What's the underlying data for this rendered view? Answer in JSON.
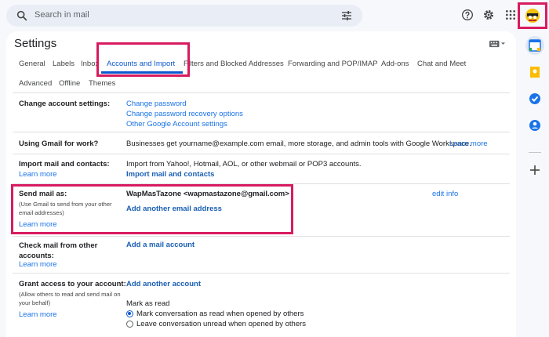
{
  "search": {
    "placeholder": "Search in mail"
  },
  "settings": {
    "title": "Settings",
    "tabs_row1": [
      "General",
      "Labels",
      "Inbox",
      "Accounts and Import",
      "Filters and Blocked Addresses",
      "Forwarding and POP/IMAP",
      "Add-ons",
      "Chat and Meet"
    ],
    "tabs_row2": [
      "Advanced",
      "Offline",
      "Themes"
    ],
    "active_tab": "Accounts and Import"
  },
  "rows": {
    "change_account": {
      "label": "Change account settings:",
      "links": [
        "Change password",
        "Change password recovery options",
        "Other Google Account settings"
      ]
    },
    "gmail_work": {
      "label": "Using Gmail for work?",
      "text": "Businesses get yourname@example.com email, more storage, and admin tools with Google Workspace.",
      "link": "Learn more"
    },
    "import": {
      "label": "Import mail and contacts:",
      "learn_more": "Learn more",
      "text": "Import from Yahoo!, Hotmail, AOL, or other webmail or POP3 accounts.",
      "action": "Import mail and contacts"
    },
    "send_as": {
      "label": "Send mail as:",
      "sub": "(Use Gmail to send from your other email addresses)",
      "learn_more": "Learn more",
      "address": "WapMasTazone <wapmastazone@gmail.com>",
      "action": "Add another email address",
      "edit": "edit info"
    },
    "check_mail": {
      "label": "Check mail from other accounts:",
      "learn_more": "Learn more",
      "action": "Add a mail account"
    },
    "grant": {
      "label": "Grant access to your account:",
      "sub": "(Allow others to read and send mail on your behalf)",
      "learn_more": "Learn more",
      "action": "Add another account",
      "mark_title": "Mark as read",
      "option1": "Mark conversation as read when opened by others",
      "option2": "Leave conversation unread when opened by others",
      "selected": "option1"
    }
  },
  "colors": {
    "accent": "#0b57d0",
    "highlight": "#d81b60",
    "link": "#1a73e8"
  },
  "icons": [
    "search-icon",
    "tune-icon",
    "help-icon",
    "gear-icon",
    "apps-icon",
    "keyboard-icon",
    "calendar-icon",
    "keep-icon",
    "tasks-icon",
    "contacts-icon",
    "plus-icon"
  ]
}
